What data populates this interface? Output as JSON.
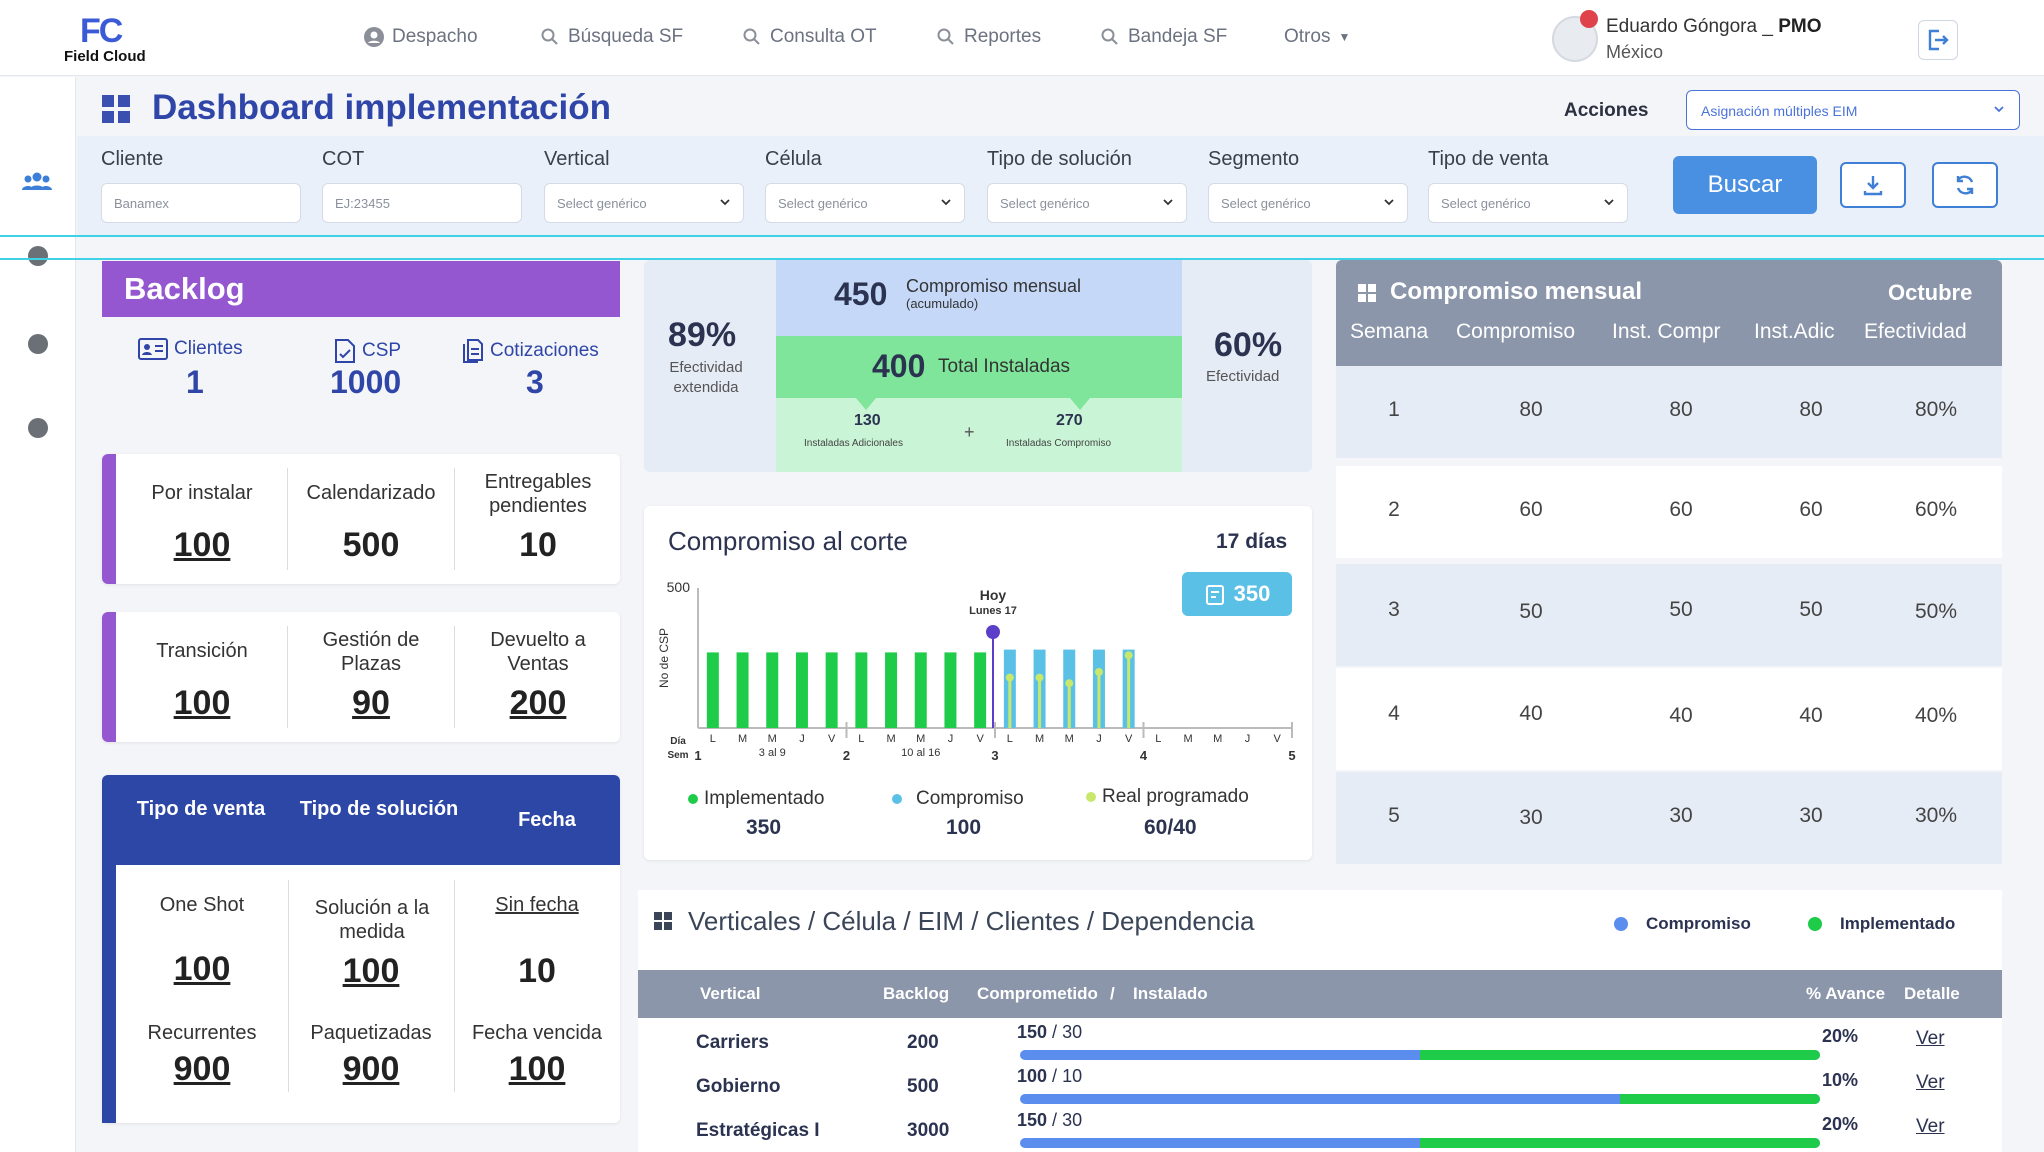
{
  "brand": {
    "logo": "FC",
    "name": "Field Cloud"
  },
  "nav": [
    {
      "label": "Despacho",
      "icon": "user-circle-icon"
    },
    {
      "label": "Búsqueda SF",
      "icon": "search-icon"
    },
    {
      "label": "Consulta OT",
      "icon": "search-icon"
    },
    {
      "label": "Reportes",
      "icon": "search-icon"
    },
    {
      "label": "Bandeja SF",
      "icon": "search-icon"
    },
    {
      "label": "Otros",
      "icon": "caret-down-icon"
    }
  ],
  "user": {
    "name": "Eduardo Góngora _",
    "role": "PMO",
    "country": "México"
  },
  "page": {
    "title": "Dashboard implementación",
    "acciones_label": "Acciones",
    "acciones_value": "Asignación múltiples EIM"
  },
  "filters": {
    "cliente": {
      "label": "Cliente",
      "value": "Banamex"
    },
    "cot": {
      "label": "COT",
      "placeholder": "EJ:23455"
    },
    "vertical": {
      "label": "Vertical",
      "value": "Select genérico"
    },
    "celula": {
      "label": "Célula",
      "value": "Select genérico"
    },
    "tipo_solucion": {
      "label": "Tipo de solución",
      "value": "Select genérico"
    },
    "segmento": {
      "label": "Segmento",
      "value": "Select genérico"
    },
    "tipo_venta": {
      "label": "Tipo de venta",
      "value": "Select genérico"
    },
    "buscar": "Buscar"
  },
  "backlog": {
    "title": "Backlog",
    "stats": [
      {
        "label": "Clientes",
        "value": "1"
      },
      {
        "label": "CSP",
        "value": "1000"
      },
      {
        "label": "Cotizaciones",
        "value": "3"
      }
    ],
    "row1": [
      {
        "label": "Por instalar",
        "value": "100"
      },
      {
        "label": "Calendarizado",
        "value": "500"
      },
      {
        "label": "Entregables pendientes",
        "value": "10"
      }
    ],
    "row2": [
      {
        "label": "Transición",
        "value": "100"
      },
      {
        "label": "Gestión de Plazas",
        "value": "90"
      },
      {
        "label": "Devuelto a Ventas",
        "value": "200"
      }
    ],
    "table_head": [
      "Tipo de venta",
      "Tipo de solución",
      "Fecha"
    ],
    "table_rows": [
      [
        {
          "label": "One Shot",
          "value": "100"
        },
        {
          "label": "Solución a la medida",
          "value": "100"
        },
        {
          "label": "Sin fecha",
          "value": "10"
        }
      ],
      [
        {
          "label": "Recurrentes",
          "value": "900"
        },
        {
          "label": "Paquetizadas",
          "value": "900"
        },
        {
          "label": "Fecha vencida",
          "value": "100"
        }
      ]
    ]
  },
  "summary": {
    "left_pct": "89%",
    "left_label": "Efectividad extendida",
    "right_pct": "60%",
    "right_label": "Efectividad",
    "compromiso_num": "450",
    "compromiso_label": "Compromiso mensual",
    "compromiso_sub": "(acumulado)",
    "instaladas_num": "400",
    "instaladas_label": "Total Instaladas",
    "adicionales_num": "130",
    "adicionales_label": "Instaladas Adicionales",
    "plus": "+",
    "compromiso_inst_num": "270",
    "compromiso_inst_label": "Instaladas Compromiso"
  },
  "corte": {
    "title": "Compromiso al corte",
    "days": "17 días",
    "badge": "350",
    "hoy": "Hoy",
    "hoy_date": "Lunes 17",
    "dia_label": "Día",
    "sem_label": "Sem",
    "legend": [
      {
        "label": "Implementado",
        "value": "350",
        "color": "#1fcc4a"
      },
      {
        "label": "Compromiso",
        "value": "100",
        "color": "#5bc0e6"
      },
      {
        "label": "Real programado",
        "value": "60/40",
        "color": "#c8e86b"
      }
    ]
  },
  "chart_data": {
    "type": "bar",
    "ylabel": "No de CSP",
    "ylim": [
      0,
      500
    ],
    "y_ticks": [
      "500"
    ],
    "day_labels": [
      "L",
      "M",
      "M",
      "J",
      "V",
      "L",
      "M",
      "M",
      "J",
      "V",
      "L",
      "M",
      "M",
      "J",
      "V",
      "L",
      "M",
      "M",
      "J",
      "V"
    ],
    "day_sublabels": [
      "3 al 9",
      "10 al 16"
    ],
    "week_labels": [
      "1",
      "2",
      "3",
      "4",
      "5"
    ],
    "series": [
      {
        "name": "Implementado",
        "color": "#1fcc4a",
        "values": [
          270,
          270,
          270,
          270,
          270,
          270,
          270,
          270,
          270,
          270,
          0,
          0,
          0,
          0,
          0,
          0,
          0,
          0,
          0,
          0
        ]
      },
      {
        "name": "Compromiso",
        "color": "#5bc0e6",
        "values": [
          0,
          0,
          0,
          0,
          0,
          0,
          0,
          0,
          0,
          0,
          280,
          280,
          280,
          280,
          280,
          0,
          0,
          0,
          0,
          0
        ]
      },
      {
        "name": "Real programado",
        "color": "#c8e86b",
        "values": [
          0,
          0,
          0,
          0,
          0,
          0,
          0,
          0,
          0,
          0,
          180,
          180,
          160,
          200,
          260,
          0,
          0,
          0,
          0,
          0
        ]
      }
    ],
    "today_index": 10
  },
  "mensual": {
    "title": "Compromiso mensual",
    "month": "Octubre",
    "headers": [
      "Semana",
      "Compromiso",
      "Inst. Compr",
      "Inst.Adic",
      "Efectividad"
    ],
    "rows": [
      [
        "1",
        "80",
        "80",
        "80",
        "80%"
      ],
      [
        "2",
        "60",
        "60",
        "60",
        "60%"
      ],
      [
        "3",
        "50",
        "50",
        "50",
        "50%"
      ],
      [
        "4",
        "40",
        "40",
        "40",
        "40%"
      ],
      [
        "5",
        "30",
        "30",
        "30",
        "30%"
      ]
    ]
  },
  "verticales": {
    "title": "Verticales / Célula / EIM / Clientes / Dependencia",
    "legend_compromiso": "Compromiso",
    "legend_implementado": "Implementado",
    "headers": {
      "vertical": "Vertical",
      "backlog": "Backlog",
      "comp": "Comprometido",
      "slash": "/",
      "inst": "Instalado",
      "avance": "% Avance",
      "detalle": "Detalle"
    },
    "rows": [
      {
        "name": "Carriers",
        "backlog": "200",
        "comp": "150",
        "inst": "30",
        "pct": "20%",
        "progress": 0.2,
        "ver": "Ver"
      },
      {
        "name": "Gobierno",
        "backlog": "500",
        "comp": "100",
        "inst": "10",
        "pct": "10%",
        "progress": 0.1,
        "ver": "Ver"
      },
      {
        "name": "Estratégicas I",
        "backlog": "3000",
        "comp": "150",
        "inst": "30",
        "pct": "20%",
        "progress": 0.2,
        "ver": "Ver"
      }
    ]
  }
}
